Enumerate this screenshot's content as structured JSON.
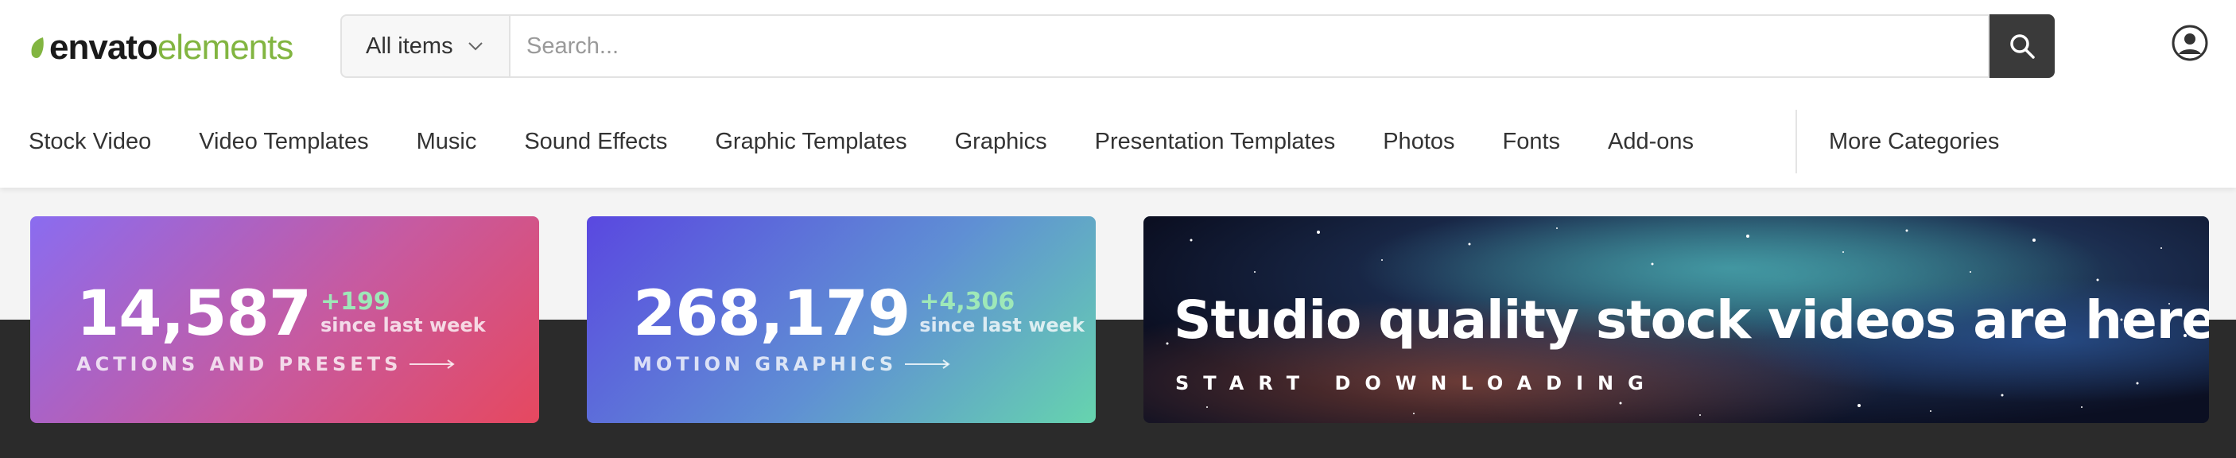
{
  "header": {
    "logo": {
      "part1": "envato",
      "part2": "elements"
    },
    "search": {
      "category": "All items",
      "placeholder": "Search..."
    },
    "icons": {
      "search": "search-icon",
      "account": "user-account-icon",
      "dropdown": "chevron-down-icon"
    }
  },
  "nav": {
    "items": [
      {
        "label": "Stock Video"
      },
      {
        "label": "Video Templates"
      },
      {
        "label": "Music"
      },
      {
        "label": "Sound Effects"
      },
      {
        "label": "Graphic Templates"
      },
      {
        "label": "Graphics"
      },
      {
        "label": "Presentation Templates"
      },
      {
        "label": "Photos"
      },
      {
        "label": "Fonts"
      },
      {
        "label": "Add-ons"
      }
    ],
    "more": "More Categories"
  },
  "cards": [
    {
      "number": "14,587",
      "delta": "+199",
      "since": "since last week",
      "label": "ACTIONS AND PRESETS"
    },
    {
      "number": "268,179",
      "delta": "+4,306",
      "since": "since last week",
      "label": "MOTION GRAPHICS"
    }
  ],
  "promo": {
    "title": "Studio quality stock videos are here",
    "cta": "START DOWNLOADING"
  },
  "colors": {
    "brand_green": "#82b541",
    "delta_green": "#9ee8b8",
    "search_button": "#3a3a3a",
    "dark_band": "#2b2b2b"
  }
}
